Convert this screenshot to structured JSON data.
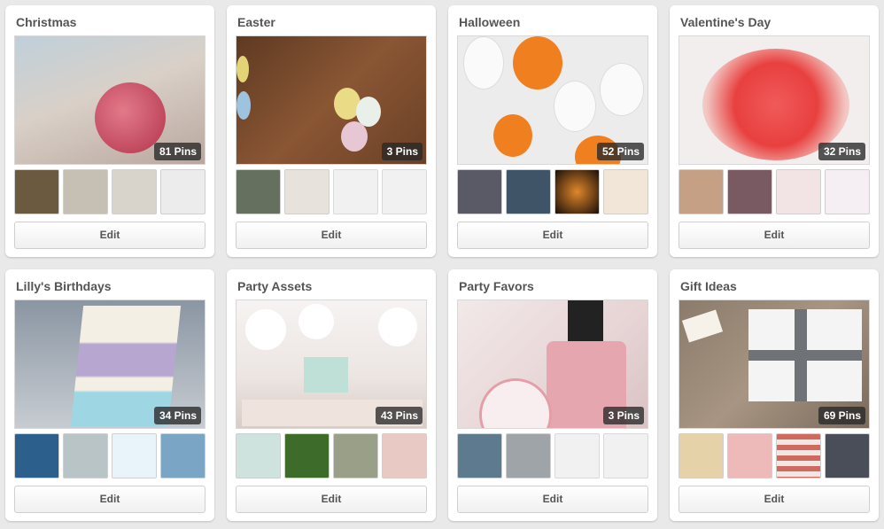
{
  "boards": [
    {
      "title": "Christmas",
      "pins": "81 Pins",
      "edit": "Edit",
      "cover": "#c9b7ad",
      "thumbs": [
        "#6b5a3f",
        "#c6c0b4",
        "#d8d3cb",
        "#ececec"
      ]
    },
    {
      "title": "Easter",
      "pins": "3 Pins",
      "edit": "Edit",
      "cover": "#7c4a2c",
      "thumbs": [
        "#66705e",
        "#e7e2dc",
        "",
        ""
      ]
    },
    {
      "title": "Halloween",
      "pins": "52 Pins",
      "edit": "Edit",
      "cover": "#e7e7e7",
      "thumbs": [
        "#5a5a66",
        "#3f5466",
        "#2a1a10",
        "#f1e6d8"
      ]
    },
    {
      "title": "Valentine's Day",
      "pins": "32 Pins",
      "edit": "Edit",
      "cover": "#f0e9e6",
      "thumbs": [
        "#c5a085",
        "#7a5a62",
        "#f2e3e4",
        "#f5eff3"
      ]
    },
    {
      "title": "Lilly's Birthdays",
      "pins": "34 Pins",
      "edit": "Edit",
      "cover": "#b9d9e2",
      "thumbs": [
        "#2d5f8c",
        "#b9c4c6",
        "#e9f4fa",
        "#7aa5c5"
      ]
    },
    {
      "title": "Party Assets",
      "pins": "43 Pins",
      "edit": "Edit",
      "cover": "#f3eeec",
      "thumbs": [
        "#cfe3de",
        "#3c6b2a",
        "#9aa087",
        "#e8c9c4"
      ]
    },
    {
      "title": "Party Favors",
      "pins": "3 Pins",
      "edit": "Edit",
      "cover": "#e9d9d9",
      "thumbs": [
        "#5d7a8e",
        "#9ea4a7",
        "",
        ""
      ]
    },
    {
      "title": "Gift Ideas",
      "pins": "69 Pins",
      "edit": "Edit",
      "cover": "#8d7f72",
      "thumbs": [
        "#e5d2a8",
        "#eeb9b9",
        "#cf6a5e",
        "#4a4e58"
      ]
    }
  ]
}
